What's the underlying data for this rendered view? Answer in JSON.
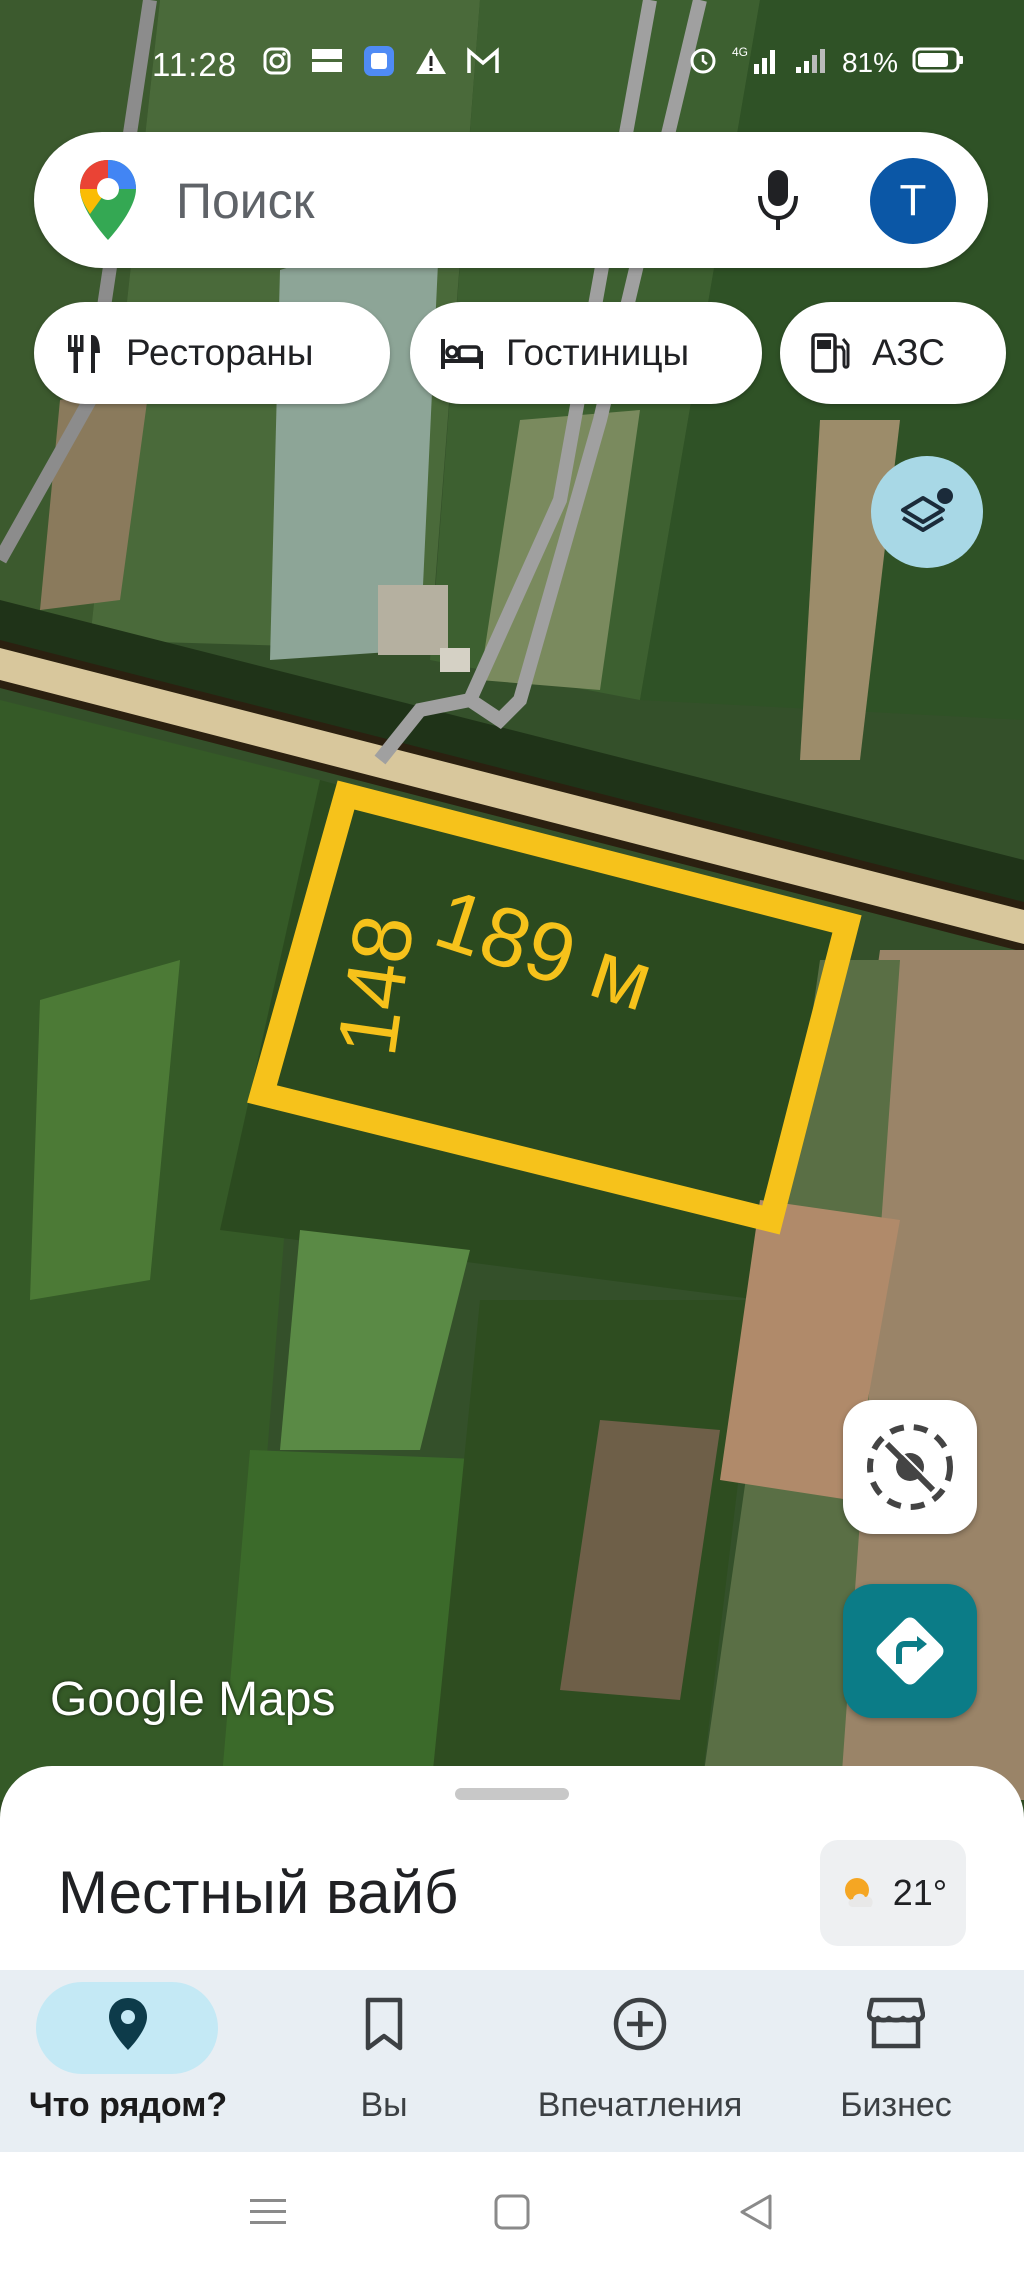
{
  "status_bar": {
    "time": "11:28",
    "app_icons": [
      "instagram-icon",
      "temu-icon",
      "app-square-icon",
      "warning-icon",
      "gmail-icon"
    ],
    "system_icons": [
      "alarm-icon",
      "signal-4g-icon",
      "signal-icon",
      "battery-icon"
    ],
    "network_label": "4G",
    "battery_percent": "81%"
  },
  "search": {
    "placeholder": "Поиск",
    "avatar_letter": "T"
  },
  "chips": [
    {
      "label": "Рестораны",
      "icon": "restaurant-icon"
    },
    {
      "label": "Гостиницы",
      "icon": "hotel-icon"
    },
    {
      "label": "АЗС",
      "icon": "gas-station-icon"
    }
  ],
  "map": {
    "measure_long": "189 м",
    "measure_short": "148",
    "watermark": "Google Maps",
    "overlay_color": "#f6c21b"
  },
  "sheet": {
    "title": "Местный вайб",
    "temperature": "21°",
    "weather_icon": "partly-cloudy-icon"
  },
  "nav": {
    "items": [
      {
        "label": "Что рядом?",
        "icon": "location-pin-icon",
        "active": true
      },
      {
        "label": "Вы",
        "icon": "bookmark-icon",
        "active": false
      },
      {
        "label": "Впечатления",
        "icon": "add-circle-icon",
        "active": false
      },
      {
        "label": "Бизнес",
        "icon": "storefront-icon",
        "active": false
      }
    ]
  },
  "colors": {
    "accent": "#0b7c87",
    "avatar": "#0b57a6",
    "nav_active_pill": "#c4e9f5"
  }
}
